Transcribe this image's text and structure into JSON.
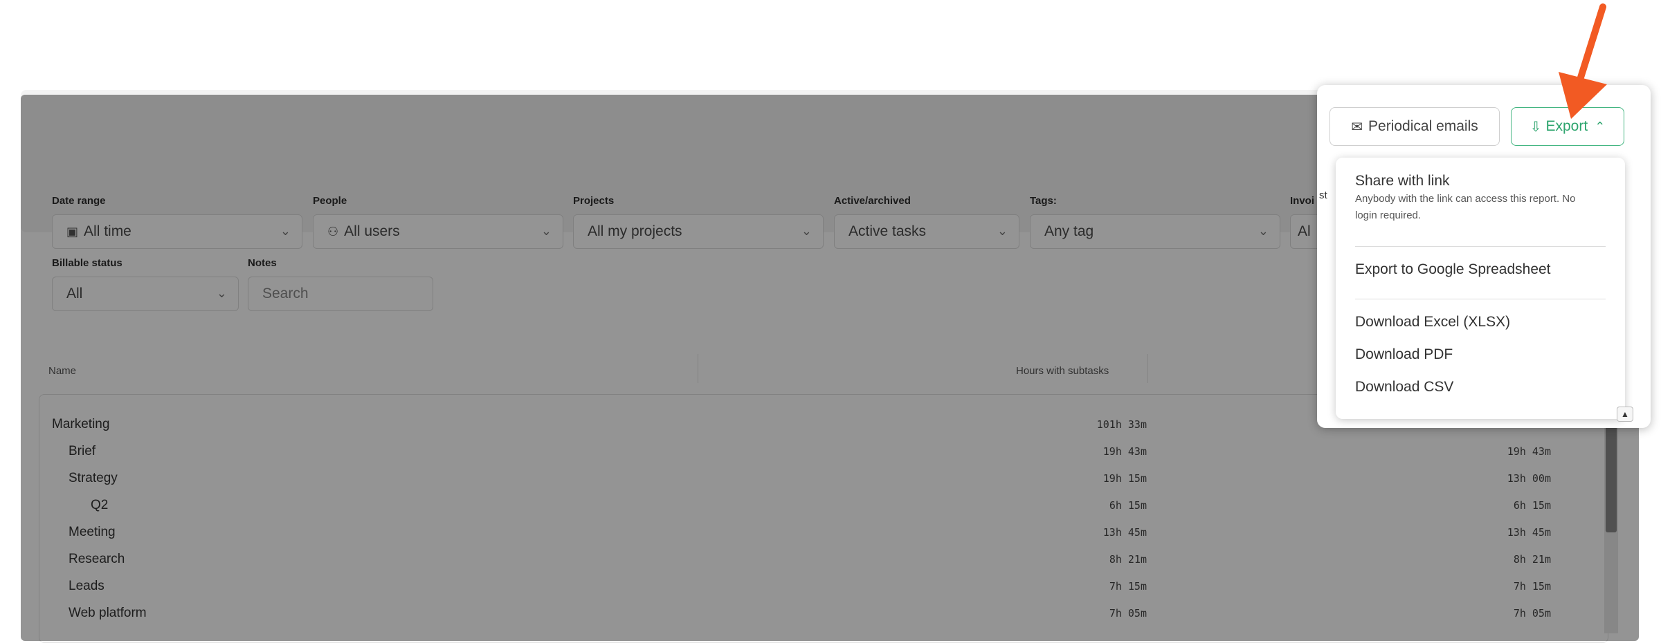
{
  "filters": {
    "date_range": {
      "label": "Date range",
      "value": "All time"
    },
    "people": {
      "label": "People",
      "value": "All users"
    },
    "projects": {
      "label": "Projects",
      "value": "All my projects"
    },
    "active_archived": {
      "label": "Active/archived",
      "value": "Active tasks"
    },
    "tags": {
      "label": "Tags:",
      "value": "Any tag"
    },
    "invoice": {
      "label": "Invoi",
      "value": "Al"
    },
    "billable_status": {
      "label": "Billable status",
      "value": "All"
    },
    "notes": {
      "label": "Notes",
      "placeholder": "Search"
    }
  },
  "table": {
    "columns": [
      "Name",
      "Hours with subtasks"
    ],
    "rows": [
      {
        "name": "Marketing",
        "hours_with_subtasks": "101h 33m",
        "hours": ""
      },
      {
        "name": "Brief",
        "hours_with_subtasks": "19h 43m",
        "hours": "19h 43m"
      },
      {
        "name": "Strategy",
        "hours_with_subtasks": "19h 15m",
        "hours": "13h 00m"
      },
      {
        "name": "Q2",
        "hours_with_subtasks": "6h 15m",
        "hours": "6h 15m"
      },
      {
        "name": "Meeting",
        "hours_with_subtasks": "13h 45m",
        "hours": "13h 45m"
      },
      {
        "name": "Research",
        "hours_with_subtasks": "8h 21m",
        "hours": "8h 21m"
      },
      {
        "name": "Leads",
        "hours_with_subtasks": "7h 15m",
        "hours": "7h 15m"
      },
      {
        "name": "Web platform",
        "hours_with_subtasks": "7h 05m",
        "hours": "7h 05m"
      }
    ]
  },
  "popup": {
    "periodical_label": "Periodical emails",
    "export_label": "Export",
    "peek": "st",
    "menu": {
      "share_title": "Share with link",
      "share_desc": "Anybody with the link can access this report. No login required.",
      "google": "Export to Google Spreadsheet",
      "excel": "Download Excel (XLSX)",
      "pdf": "Download PDF",
      "csv": "Download CSV"
    }
  },
  "icons": {
    "calendar": "calendar-icon",
    "users": "users-icon",
    "mail": "mail-icon",
    "export": "export-icon",
    "chevron": "chevron-down-icon"
  },
  "colors": {
    "accent_green": "#43b581",
    "annotation_arrow": "#f25a23"
  }
}
